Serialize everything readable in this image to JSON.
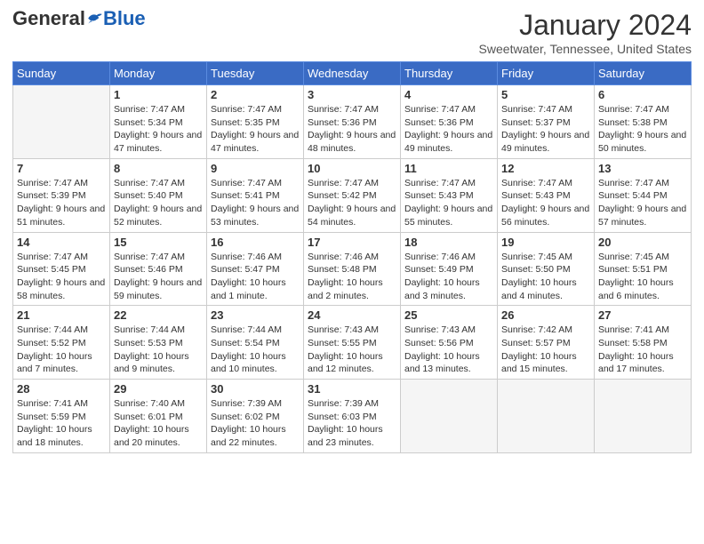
{
  "header": {
    "logo": {
      "text_general": "General",
      "text_blue": "Blue"
    },
    "title": "January 2024",
    "subtitle": "Sweetwater, Tennessee, United States"
  },
  "days_of_week": [
    "Sunday",
    "Monday",
    "Tuesday",
    "Wednesday",
    "Thursday",
    "Friday",
    "Saturday"
  ],
  "weeks": [
    [
      {
        "day": "",
        "empty": true
      },
      {
        "day": "1",
        "sunrise": "Sunrise: 7:47 AM",
        "sunset": "Sunset: 5:34 PM",
        "daylight": "Daylight: 9 hours and 47 minutes."
      },
      {
        "day": "2",
        "sunrise": "Sunrise: 7:47 AM",
        "sunset": "Sunset: 5:35 PM",
        "daylight": "Daylight: 9 hours and 47 minutes."
      },
      {
        "day": "3",
        "sunrise": "Sunrise: 7:47 AM",
        "sunset": "Sunset: 5:36 PM",
        "daylight": "Daylight: 9 hours and 48 minutes."
      },
      {
        "day": "4",
        "sunrise": "Sunrise: 7:47 AM",
        "sunset": "Sunset: 5:36 PM",
        "daylight": "Daylight: 9 hours and 49 minutes."
      },
      {
        "day": "5",
        "sunrise": "Sunrise: 7:47 AM",
        "sunset": "Sunset: 5:37 PM",
        "daylight": "Daylight: 9 hours and 49 minutes."
      },
      {
        "day": "6",
        "sunrise": "Sunrise: 7:47 AM",
        "sunset": "Sunset: 5:38 PM",
        "daylight": "Daylight: 9 hours and 50 minutes."
      }
    ],
    [
      {
        "day": "7",
        "sunrise": "Sunrise: 7:47 AM",
        "sunset": "Sunset: 5:39 PM",
        "daylight": "Daylight: 9 hours and 51 minutes."
      },
      {
        "day": "8",
        "sunrise": "Sunrise: 7:47 AM",
        "sunset": "Sunset: 5:40 PM",
        "daylight": "Daylight: 9 hours and 52 minutes."
      },
      {
        "day": "9",
        "sunrise": "Sunrise: 7:47 AM",
        "sunset": "Sunset: 5:41 PM",
        "daylight": "Daylight: 9 hours and 53 minutes."
      },
      {
        "day": "10",
        "sunrise": "Sunrise: 7:47 AM",
        "sunset": "Sunset: 5:42 PM",
        "daylight": "Daylight: 9 hours and 54 minutes."
      },
      {
        "day": "11",
        "sunrise": "Sunrise: 7:47 AM",
        "sunset": "Sunset: 5:43 PM",
        "daylight": "Daylight: 9 hours and 55 minutes."
      },
      {
        "day": "12",
        "sunrise": "Sunrise: 7:47 AM",
        "sunset": "Sunset: 5:43 PM",
        "daylight": "Daylight: 9 hours and 56 minutes."
      },
      {
        "day": "13",
        "sunrise": "Sunrise: 7:47 AM",
        "sunset": "Sunset: 5:44 PM",
        "daylight": "Daylight: 9 hours and 57 minutes."
      }
    ],
    [
      {
        "day": "14",
        "sunrise": "Sunrise: 7:47 AM",
        "sunset": "Sunset: 5:45 PM",
        "daylight": "Daylight: 9 hours and 58 minutes."
      },
      {
        "day": "15",
        "sunrise": "Sunrise: 7:47 AM",
        "sunset": "Sunset: 5:46 PM",
        "daylight": "Daylight: 9 hours and 59 minutes."
      },
      {
        "day": "16",
        "sunrise": "Sunrise: 7:46 AM",
        "sunset": "Sunset: 5:47 PM",
        "daylight": "Daylight: 10 hours and 1 minute."
      },
      {
        "day": "17",
        "sunrise": "Sunrise: 7:46 AM",
        "sunset": "Sunset: 5:48 PM",
        "daylight": "Daylight: 10 hours and 2 minutes."
      },
      {
        "day": "18",
        "sunrise": "Sunrise: 7:46 AM",
        "sunset": "Sunset: 5:49 PM",
        "daylight": "Daylight: 10 hours and 3 minutes."
      },
      {
        "day": "19",
        "sunrise": "Sunrise: 7:45 AM",
        "sunset": "Sunset: 5:50 PM",
        "daylight": "Daylight: 10 hours and 4 minutes."
      },
      {
        "day": "20",
        "sunrise": "Sunrise: 7:45 AM",
        "sunset": "Sunset: 5:51 PM",
        "daylight": "Daylight: 10 hours and 6 minutes."
      }
    ],
    [
      {
        "day": "21",
        "sunrise": "Sunrise: 7:44 AM",
        "sunset": "Sunset: 5:52 PM",
        "daylight": "Daylight: 10 hours and 7 minutes."
      },
      {
        "day": "22",
        "sunrise": "Sunrise: 7:44 AM",
        "sunset": "Sunset: 5:53 PM",
        "daylight": "Daylight: 10 hours and 9 minutes."
      },
      {
        "day": "23",
        "sunrise": "Sunrise: 7:44 AM",
        "sunset": "Sunset: 5:54 PM",
        "daylight": "Daylight: 10 hours and 10 minutes."
      },
      {
        "day": "24",
        "sunrise": "Sunrise: 7:43 AM",
        "sunset": "Sunset: 5:55 PM",
        "daylight": "Daylight: 10 hours and 12 minutes."
      },
      {
        "day": "25",
        "sunrise": "Sunrise: 7:43 AM",
        "sunset": "Sunset: 5:56 PM",
        "daylight": "Daylight: 10 hours and 13 minutes."
      },
      {
        "day": "26",
        "sunrise": "Sunrise: 7:42 AM",
        "sunset": "Sunset: 5:57 PM",
        "daylight": "Daylight: 10 hours and 15 minutes."
      },
      {
        "day": "27",
        "sunrise": "Sunrise: 7:41 AM",
        "sunset": "Sunset: 5:58 PM",
        "daylight": "Daylight: 10 hours and 17 minutes."
      }
    ],
    [
      {
        "day": "28",
        "sunrise": "Sunrise: 7:41 AM",
        "sunset": "Sunset: 5:59 PM",
        "daylight": "Daylight: 10 hours and 18 minutes."
      },
      {
        "day": "29",
        "sunrise": "Sunrise: 7:40 AM",
        "sunset": "Sunset: 6:01 PM",
        "daylight": "Daylight: 10 hours and 20 minutes."
      },
      {
        "day": "30",
        "sunrise": "Sunrise: 7:39 AM",
        "sunset": "Sunset: 6:02 PM",
        "daylight": "Daylight: 10 hours and 22 minutes."
      },
      {
        "day": "31",
        "sunrise": "Sunrise: 7:39 AM",
        "sunset": "Sunset: 6:03 PM",
        "daylight": "Daylight: 10 hours and 23 minutes."
      },
      {
        "day": "",
        "empty": true
      },
      {
        "day": "",
        "empty": true
      },
      {
        "day": "",
        "empty": true
      }
    ]
  ]
}
